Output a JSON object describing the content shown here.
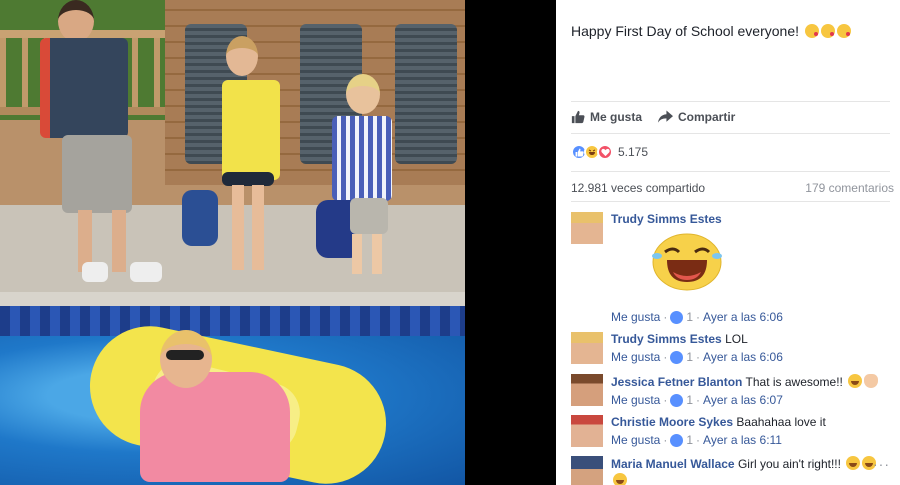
{
  "post": {
    "text": "Happy First Day of School everyone!",
    "text_emojis": [
      "kissing-heart-emoji",
      "kissing-heart-emoji",
      "kissing-heart-emoji"
    ]
  },
  "actions": {
    "like_label": "Me gusta",
    "share_label": "Compartir"
  },
  "reactions": {
    "types": [
      "like",
      "haha",
      "love"
    ],
    "count": "5.175"
  },
  "stats": {
    "shares": "12.981 veces compartido",
    "comments": "179 comentarios"
  },
  "comments": [
    {
      "author": "Trudy Simms Estes",
      "text": "",
      "sticker": "laughing-emoji-sticker",
      "like_label": "Me gusta",
      "likes": "1",
      "time": "Ayer a las 6:06"
    },
    {
      "author": "Trudy Simms Estes",
      "text": "LOL",
      "like_label": "Me gusta",
      "likes": "1",
      "time": "Ayer a las 6:06"
    },
    {
      "author": "Jessica Fetner Blanton",
      "text": "That is awesome!!",
      "like_label": "Me gusta",
      "likes": "1",
      "time": "Ayer a las 6:07"
    },
    {
      "author": "Christie Moore Sykes",
      "text": "Baahahaa love it",
      "like_label": "Me gusta",
      "likes": "1",
      "time": "Ayer a las 6:11"
    },
    {
      "author": "Maria Manuel Wallace",
      "text": "Girl you ain't right!!!"
    }
  ],
  "separator": "·",
  "colors": {
    "link": "#365899",
    "meta": "#90949c",
    "like_blue": "#5890ff",
    "love_red": "#f25268",
    "haha_yellow": "#f7c640"
  }
}
